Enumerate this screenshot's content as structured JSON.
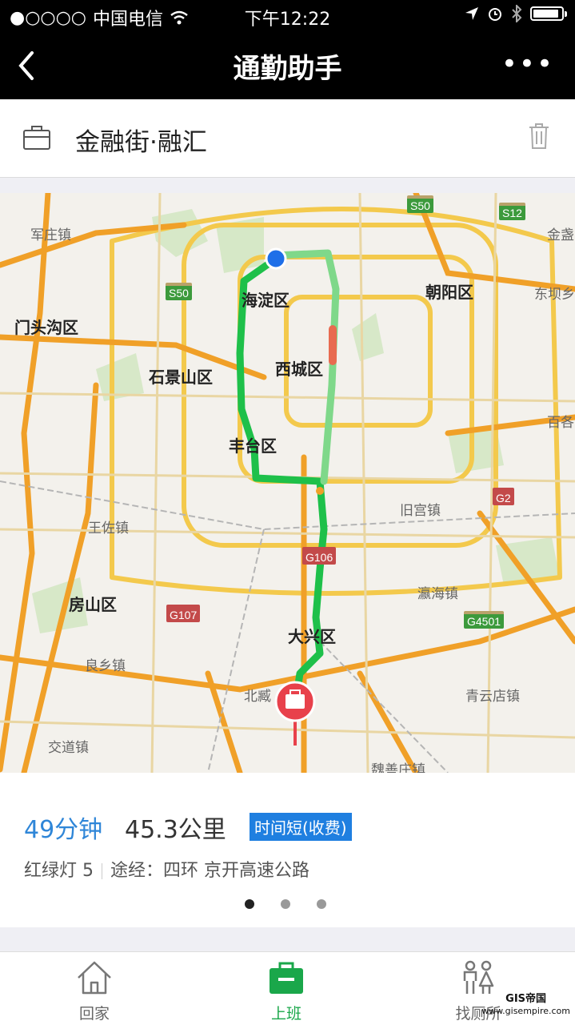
{
  "status_bar": {
    "signal": "●○○○○",
    "carrier": "中国电信",
    "time": "下午12:22",
    "battery_level": 0.9
  },
  "nav": {
    "title": "通勤助手",
    "more": "•••"
  },
  "destination": {
    "name": "金融街·融汇"
  },
  "map": {
    "districts": [
      "海淀区",
      "朝阳区",
      "门头沟区",
      "西城区",
      "石景山区",
      "丰台区",
      "房山区",
      "大兴区"
    ],
    "towns": [
      "军庄镇",
      "金盏",
      "东坝乡",
      "王佐镇",
      "旧宫镇",
      "瀛海镇",
      "良乡镇",
      "北臧",
      "青云店镇",
      "交道镇",
      "魏善庄镇",
      "百各"
    ],
    "road_shields": [
      "S50",
      "S12",
      "S50",
      "G2",
      "G106",
      "G107",
      "G4501"
    ]
  },
  "route": {
    "duration": "49分钟",
    "distance": "45.3公里",
    "tag": "时间短(收费)",
    "lights": "红绿灯 5",
    "via": "途经：四环 京开高速公路",
    "page_count": 3,
    "active_page": 1
  },
  "tabs": [
    {
      "label": "回家",
      "icon": "home-icon"
    },
    {
      "label": "上班",
      "icon": "briefcase-icon"
    },
    {
      "label": "找厕所",
      "icon": "restroom-icon"
    }
  ],
  "watermark": {
    "line1": "GIS帝国",
    "line2": "www.gisempire.com"
  },
  "colors": {
    "accent_blue": "#2f86d8",
    "tag_blue": "#1f7fe0",
    "tab_active": "#1aa74a",
    "route_green": "#1ec04a",
    "route_light_green": "#7fd88a",
    "destination_red": "#e8414b"
  }
}
